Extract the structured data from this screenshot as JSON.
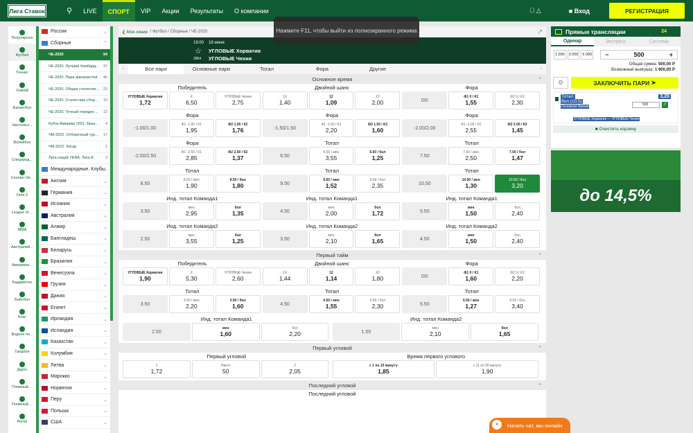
{
  "header": {
    "logo": "Лига Ставок",
    "nav": [
      "LIVE",
      "СПОРТ",
      "VIP",
      "Акции",
      "Результаты",
      "О компании"
    ],
    "active": "СПОРТ",
    "login": "Вход",
    "register": "РЕГИСТРАЦИЯ"
  },
  "overlay": "Нажмите F11, чтобы выйти из полноэкранного режима",
  "sports": [
    "Популярное",
    "Футбол",
    "Теннис",
    "Хоккей",
    "Баскетбол",
    "Настольн...",
    "Волейбол",
    "Спецпред...",
    "Counter-Str...",
    "Dota 2",
    "League of ...",
    "MMA",
    "Австралий...",
    "Американ...",
    "Бадминтон",
    "Бейсбол",
    "Бокс",
    "Водное по...",
    "Гандбол",
    "Дартс",
    "Пляжный ...",
    "Пляжный ...",
    "Регби"
  ],
  "countries_top": [
    {
      "name": "Россия",
      "flag": "#d52b1e"
    },
    {
      "name": "Сборные",
      "flag": "#3a7bd5"
    }
  ],
  "competitions": [
    {
      "name": "ЧЕ-2020",
      "count": "94"
    },
    {
      "name": "ЧЕ-2020. Лучший бомбард...",
      "count": "37"
    },
    {
      "name": "ЧЕ-2020. Пара финалистов",
      "count": "46"
    },
    {
      "name": "ЧЕ-2020. Общая статистик...",
      "count": "23"
    },
    {
      "name": "ЧЕ-2020. Статистика сбор...",
      "count": "10"
    },
    {
      "name": "ЧЕ-2020. Точный порядок ...",
      "count": "12"
    },
    {
      "name": "Кубок Америки 2021. Браз...",
      "count": "4"
    },
    {
      "name": "ЧМ-2022. Отборочный тур...",
      "count": "17"
    },
    {
      "name": "ЧМ-2022. Катар",
      "count": "1"
    },
    {
      "name": "Лига наций УЕФА. Лига А",
      "count": "3"
    }
  ],
  "countries": [
    {
      "name": "Международные. Клубы",
      "flag": "#3a7bd5"
    },
    {
      "name": "Англия",
      "flag": "#cf142b"
    },
    {
      "name": "Германия",
      "flag": "#222"
    },
    {
      "name": "Испания",
      "flag": "#c60b1e"
    },
    {
      "name": "Австралия",
      "flag": "#012169"
    },
    {
      "name": "Алжир",
      "flag": "#006233"
    },
    {
      "name": "Бангладеш",
      "flag": "#006a4e"
    },
    {
      "name": "Беларусь",
      "flag": "#c8313e"
    },
    {
      "name": "Бразилия",
      "flag": "#009c3b"
    },
    {
      "name": "Венесуэла",
      "flag": "#cf142b"
    },
    {
      "name": "Грузия",
      "flag": "#e00"
    },
    {
      "name": "Дания",
      "flag": "#c60c30"
    },
    {
      "name": "Египет",
      "flag": "#ce1126"
    },
    {
      "name": "Ирландия",
      "flag": "#169b62"
    },
    {
      "name": "Исландия",
      "flag": "#02529c"
    },
    {
      "name": "Казахстан",
      "flag": "#00afca"
    },
    {
      "name": "Колумбия",
      "flag": "#fcd116"
    },
    {
      "name": "Литва",
      "flag": "#fdb913"
    },
    {
      "name": "Марокко",
      "flag": "#c1272d"
    },
    {
      "name": "Норвегия",
      "flag": "#ba0c2f"
    },
    {
      "name": "Перу",
      "flag": "#d91023"
    },
    {
      "name": "Польша",
      "flag": "#dc143c"
    },
    {
      "name": "США",
      "flag": "#3c3b6e"
    }
  ],
  "breadcrumb": {
    "back": "Моя линия",
    "path": "/ Футбол / Сборные / ЧЕ-2020"
  },
  "match": {
    "time": "19:00",
    "date": "18 июня",
    "team1": "УГЛОВЫЕ Хорватия",
    "team2": "УГЛОВЫЕ Чехия",
    "id": "2864"
  },
  "tabs": [
    "Все пари",
    "Основные пари",
    "Тотал",
    "Фора",
    "Другие"
  ],
  "section1": "Основное время",
  "section2": "Первый тайм",
  "section3": "Первый угловой",
  "section4": "Последний угловой",
  "section4b": "Последний угловой",
  "markets_main": [
    [
      {
        "title": "Победитель",
        "cells": [
          [
            "УГЛОВЫЕ Хорватия",
            "1,72",
            "b"
          ],
          [
            "Х",
            "6,50",
            ""
          ],
          [
            "УГЛОВЫЕ Чехия",
            "2,75",
            ""
          ]
        ]
      },
      {
        "title": "Двойной шанс",
        "cells": [
          [
            "1Х",
            "1,40",
            ""
          ],
          [
            "12",
            "1,09",
            "b"
          ],
          [
            "Х2",
            "2,00",
            ""
          ]
        ]
      },
      {
        "title": "Фора",
        "cells": [
          [
            "",
            "0/0",
            "g"
          ],
          [
            "Ф1 0 / К1",
            "1,55",
            "b"
          ],
          [
            "Ф2 0 / К2",
            "2,30",
            ""
          ]
        ]
      }
    ],
    [
      {
        "title": "Фора",
        "cells": [
          [
            "",
            "-1.00/1.00",
            "g"
          ],
          [
            "Ф1 -1.00 / К1",
            "1,95",
            ""
          ],
          [
            "Ф2 1.00 / К2",
            "1,76",
            "b"
          ]
        ]
      },
      {
        "title": "Фора",
        "cells": [
          [
            "",
            "-1.50/1.50",
            "g"
          ],
          [
            "Ф1 -1.50 / К1",
            "2,20",
            ""
          ],
          [
            "Ф2 1.50 / К2",
            "1,60",
            "b"
          ]
        ]
      },
      {
        "title": "Фора",
        "cells": [
          [
            "",
            "-2.00/2.00",
            "g"
          ],
          [
            "Ф1 -2.00 / К1",
            "2,55",
            ""
          ],
          [
            "Ф2 2.00 / К2",
            "1,45",
            "b"
          ]
        ]
      }
    ],
    [
      {
        "title": "Фора",
        "cells": [
          [
            "",
            "-2.50/2.50",
            "g"
          ],
          [
            "Ф1 -2.50 / К1",
            "2,85",
            ""
          ],
          [
            "Ф2 2.50 / К2",
            "1,37",
            "b"
          ]
        ]
      },
      {
        "title": "Тотал",
        "cells": [
          [
            "",
            "6.50",
            "g"
          ],
          [
            "6.50 / мен",
            "3,55",
            ""
          ],
          [
            "6.50 / бол",
            "1,25",
            "b"
          ]
        ]
      },
      {
        "title": "Тотал",
        "cells": [
          [
            "",
            "7.50",
            "g"
          ],
          [
            "7.50 / мен",
            "2,50",
            ""
          ],
          [
            "7.50 / бол",
            "1,47",
            "b"
          ]
        ]
      }
    ],
    [
      {
        "title": "Тотал",
        "cells": [
          [
            "",
            "8.50",
            "g"
          ],
          [
            "8.50 / мен",
            "1,90",
            ""
          ],
          [
            "8.50 / бол",
            "1,80",
            "b"
          ]
        ]
      },
      {
        "title": "Тотал",
        "cells": [
          [
            "",
            "9.50",
            "g"
          ],
          [
            "9.50 / мен",
            "1,52",
            "b"
          ],
          [
            "9.50 / бол",
            "2,35",
            ""
          ]
        ]
      },
      {
        "title": "Тотал",
        "cells": [
          [
            "",
            "10.50",
            "g"
          ],
          [
            "10.50 / мен",
            "1,30",
            "b"
          ],
          [
            "10.50 / бол",
            "3,20",
            "hl"
          ]
        ]
      }
    ],
    [
      {
        "title": "Инд. тотал Команда1",
        "cells": [
          [
            "",
            "3.50",
            "g"
          ],
          [
            "мен",
            "2,95",
            ""
          ],
          [
            "бол",
            "1,35",
            "b"
          ]
        ]
      },
      {
        "title": "Инд. тотал Команда1",
        "cells": [
          [
            "",
            "4.50",
            "g"
          ],
          [
            "мен",
            "2,00",
            ""
          ],
          [
            "бол",
            "1,72",
            "b"
          ]
        ]
      },
      {
        "title": "Инд. тотал Команда1",
        "cells": [
          [
            "",
            "5.50",
            "g"
          ],
          [
            "мен",
            "1,50",
            "b"
          ],
          [
            "бол",
            "2,40",
            ""
          ]
        ]
      }
    ],
    [
      {
        "title": "Инд. тотал Команда2",
        "cells": [
          [
            "",
            "2.50",
            "g"
          ],
          [
            "мен",
            "3,55",
            ""
          ],
          [
            "бол",
            "1,25",
            "b"
          ]
        ]
      },
      {
        "title": "Инд. тотал Команда2",
        "cells": [
          [
            "",
            "3.50",
            "g"
          ],
          [
            "мен",
            "2,10",
            ""
          ],
          [
            "бол",
            "1,65",
            "b"
          ]
        ]
      },
      {
        "title": "Инд. тотал Команда2",
        "cells": [
          [
            "",
            "4.50",
            "g"
          ],
          [
            "мен",
            "1,50",
            "b"
          ],
          [
            "бол",
            "2,40",
            ""
          ]
        ]
      }
    ]
  ],
  "markets_half": [
    [
      {
        "title": "Победитель",
        "cells": [
          [
            "УГЛОВЫЕ Хорватия",
            "1,90",
            "b"
          ],
          [
            "Х",
            "5,30",
            ""
          ],
          [
            "УГЛОВЫЕ Чехия",
            "2,60",
            ""
          ]
        ]
      },
      {
        "title": "Двойной шанс",
        "cells": [
          [
            "1Х",
            "1,44",
            ""
          ],
          [
            "12",
            "1,14",
            "b"
          ],
          [
            "Х2",
            "1,80",
            ""
          ]
        ]
      },
      {
        "title": "Фора",
        "cells": [
          [
            "Ф1 0 / К1",
            "1,60",
            "b"
          ],
          [
            "Ф2 0 / К2",
            "2,20",
            ""
          ]
        ]
      }
    ],
    [
      {
        "title": "Тотал",
        "cells": [
          [
            "",
            "3.50",
            "g"
          ],
          [
            "3.50 / мен",
            "2,20",
            ""
          ],
          [
            "3.50 / бол",
            "1,60",
            "b"
          ]
        ]
      },
      {
        "title": "Тотал",
        "cells": [
          [
            "",
            "4.50",
            "g"
          ],
          [
            "4.50 / мен",
            "1,55",
            "b"
          ],
          [
            "4.50 / бол",
            "2,30",
            ""
          ]
        ]
      },
      {
        "title": "Тотал",
        "cells": [
          [
            "",
            "5.50",
            "g"
          ],
          [
            "5.50 / мен",
            "1,27",
            "b"
          ],
          [
            "5.50 / бол",
            "3,40",
            ""
          ]
        ]
      }
    ]
  ],
  "half_ind": [
    {
      "title": "Инд. тотал Команда1",
      "cells": [
        [
          "",
          "2.50",
          "g"
        ],
        [
          "мен",
          "1,60",
          "b"
        ],
        [
          "бол",
          "2,20",
          ""
        ]
      ]
    },
    {
      "title": "Инд. тотал Команда2",
      "cells": [
        [
          "",
          "1.50",
          "g"
        ],
        [
          "мен",
          "2,10",
          ""
        ],
        [
          "бол",
          "1,65",
          "b"
        ]
      ]
    }
  ],
  "first_corner": [
    {
      "title": "Первый угловой",
      "cells": [
        [
          "1",
          "1,72",
          ""
        ],
        [
          "Никто",
          "50",
          ""
        ],
        [
          "2",
          "2,05",
          ""
        ]
      ]
    },
    {
      "title": "Время первого углового",
      "cells": [
        [
          "с 1 по 10 минуту",
          "1,85",
          "b"
        ],
        [
          "с 11 по 90 минуту",
          "1,90",
          ""
        ]
      ]
    }
  ],
  "betslip": {
    "title": "Прямые трансляции",
    "count": "24",
    "tabs": [
      "Одинар",
      "Экспресс",
      "Система"
    ],
    "stakes": [
      "1 000",
      "3 000",
      "5 000"
    ],
    "stake": "500",
    "total_label": "Общая сумма:",
    "total": "500,00 Р",
    "win_label": "Возможный выигрыш:",
    "win": "1 600,00 Р",
    "place": "ЗАКЛЮЧИТЬ ПАРИ",
    "sel1": "Тотал:",
    "sel2": "бол (10,5)",
    "sel3": "Основное Время",
    "odds": "3,20",
    "input": "500",
    "match": "УГЛОВЫЕ Хорватия — УГЛОВЫЕ Чехия",
    "clear": "Очистить корзину"
  },
  "promo": "до 14,5%",
  "chat": "Начать чат, мы онлайн"
}
